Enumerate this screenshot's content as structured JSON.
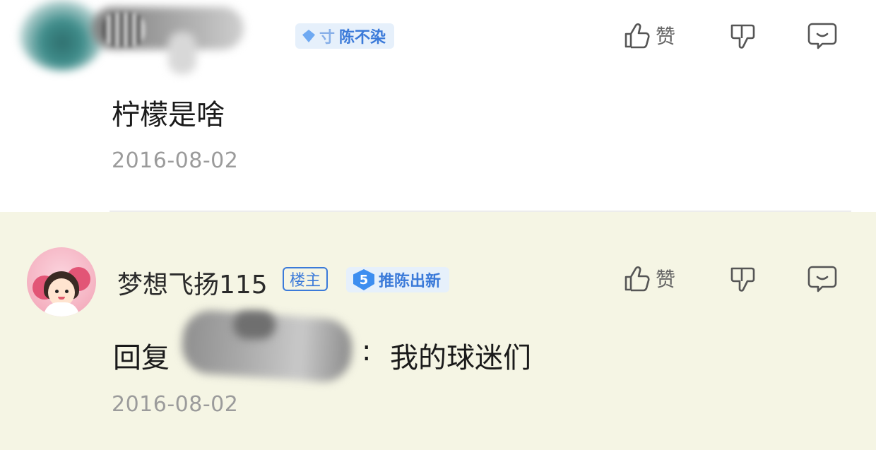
{
  "comments": [
    {
      "badge": {
        "text": "陈不染",
        "prefix": "寸"
      },
      "body": "柠檬是啥",
      "date": "2016-08-02",
      "actions": {
        "like_label": "赞"
      }
    },
    {
      "username": "梦想飞扬115",
      "owner_tag": "楼主",
      "badge": {
        "level": "5",
        "text": "推陈出新"
      },
      "reply_prefix": "回复",
      "reply_colon": ":",
      "body": "我的球迷们",
      "date": "2016-08-02",
      "actions": {
        "like_label": "赞"
      }
    }
  ],
  "icons": [
    "thumbs-up-icon",
    "thumbs-down-icon",
    "reply-bubble-icon",
    "level-gem-icon"
  ],
  "colors": {
    "accent_blue": "#3b7ad9",
    "badge_bg": "#e6f0fb",
    "highlight_bg": "#f5f5e4",
    "date_gray": "#9b9b9b"
  }
}
